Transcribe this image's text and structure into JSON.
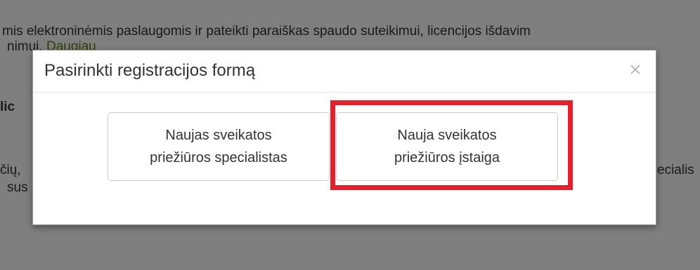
{
  "background": {
    "line1": "mis elektroninėmis paslaugomis ir pateikti paraiškas spaudo suteikimui, licencijos išdavim",
    "line2_text": "nimui.",
    "line2_link": "Daugiau",
    "heading_fragment": "lic",
    "para_fragment_1": "čių,",
    "para_fragment_1_right": "ecialis",
    "para_fragment_2": "sus"
  },
  "modal": {
    "title": "Pasirinkti registracijos formą",
    "close_icon": "close-icon",
    "options": [
      {
        "line1": "Naujas sveikatos",
        "line2": "priežiūros specialistas"
      },
      {
        "line1": "Nauja sveikatos",
        "line2": "priežiūros įstaiga"
      }
    ]
  },
  "colors": {
    "highlight": "#e3202b",
    "overlay": "rgba(0,0,0,0.5)",
    "link": "#5a7d00"
  }
}
